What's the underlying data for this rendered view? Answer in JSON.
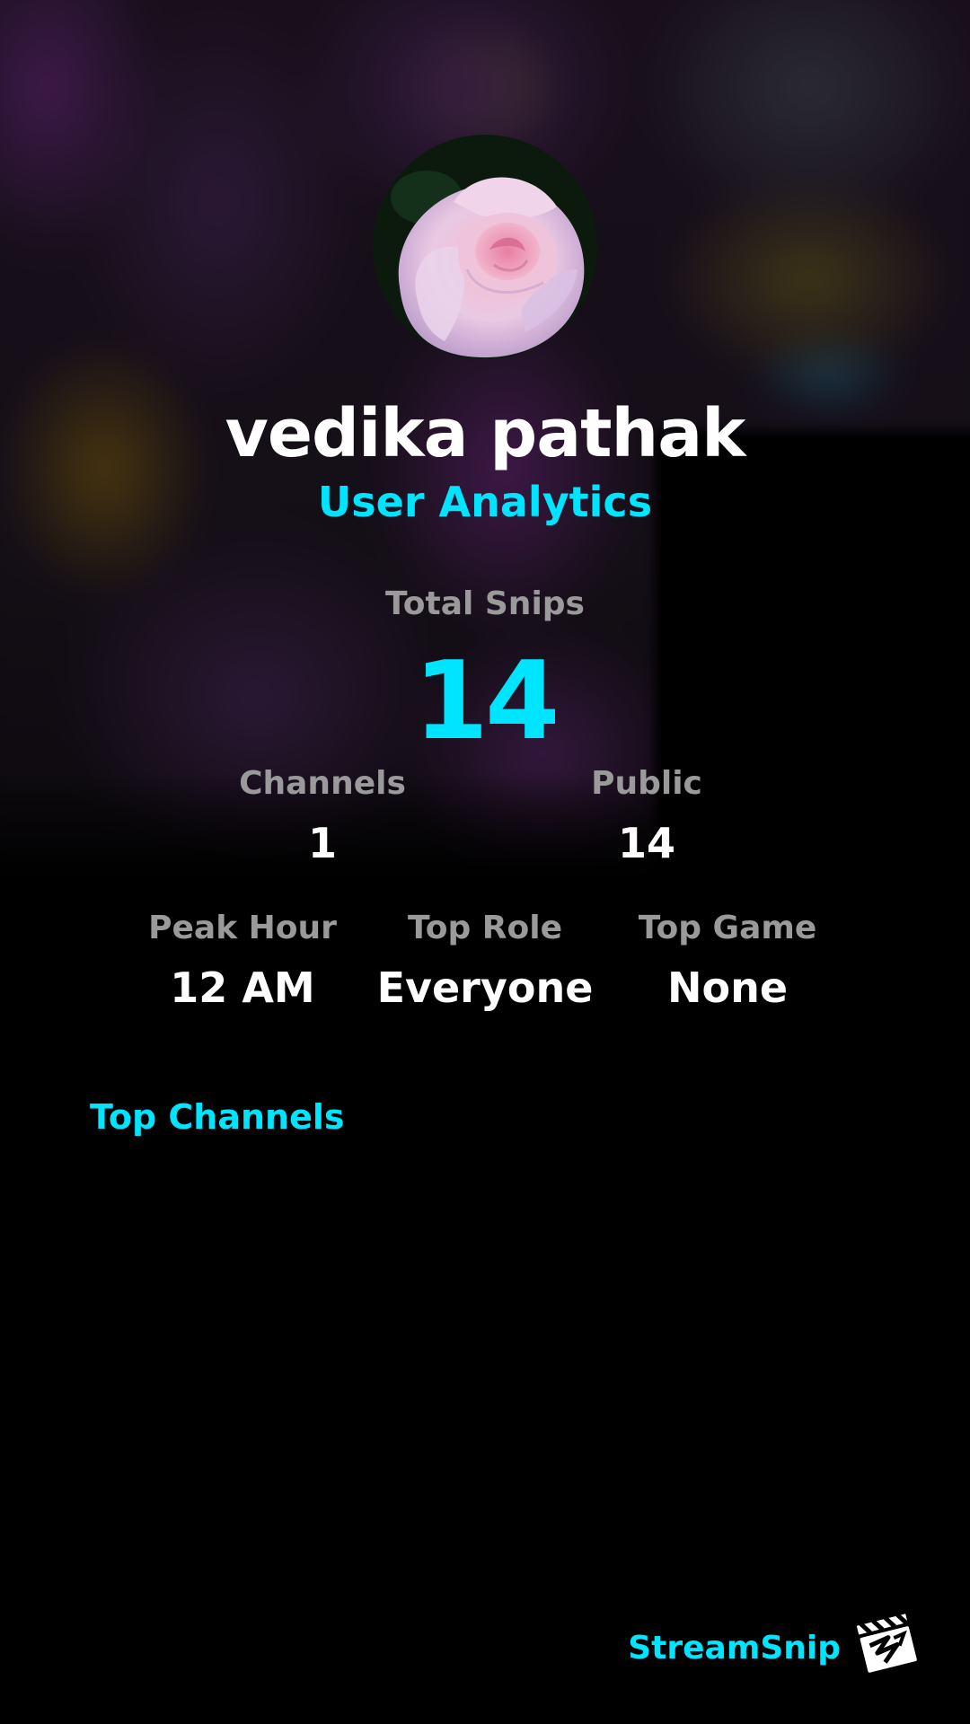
{
  "profile": {
    "username": "vedika pathak",
    "subtitle": "User Analytics"
  },
  "stats": {
    "total_snips_label": "Total Snips",
    "total_snips_value": "14",
    "channels_label": "Channels",
    "channels_value": "1",
    "public_label": "Public",
    "public_value": "14",
    "peak_hour_label": "Peak Hour",
    "peak_hour_value": "12 AM",
    "top_role_label": "Top Role",
    "top_role_value": "Everyone",
    "top_game_label": "Top Game",
    "top_game_value": "None"
  },
  "sections": {
    "top_channels_title": "Top Channels"
  },
  "branding": {
    "name": "StreamSnip",
    "logo_icon": "clapperboard-icon"
  },
  "colors": {
    "accent": "#00e5ff",
    "label": "#9a9a9a",
    "background": "#000000",
    "text": "#ffffff"
  }
}
